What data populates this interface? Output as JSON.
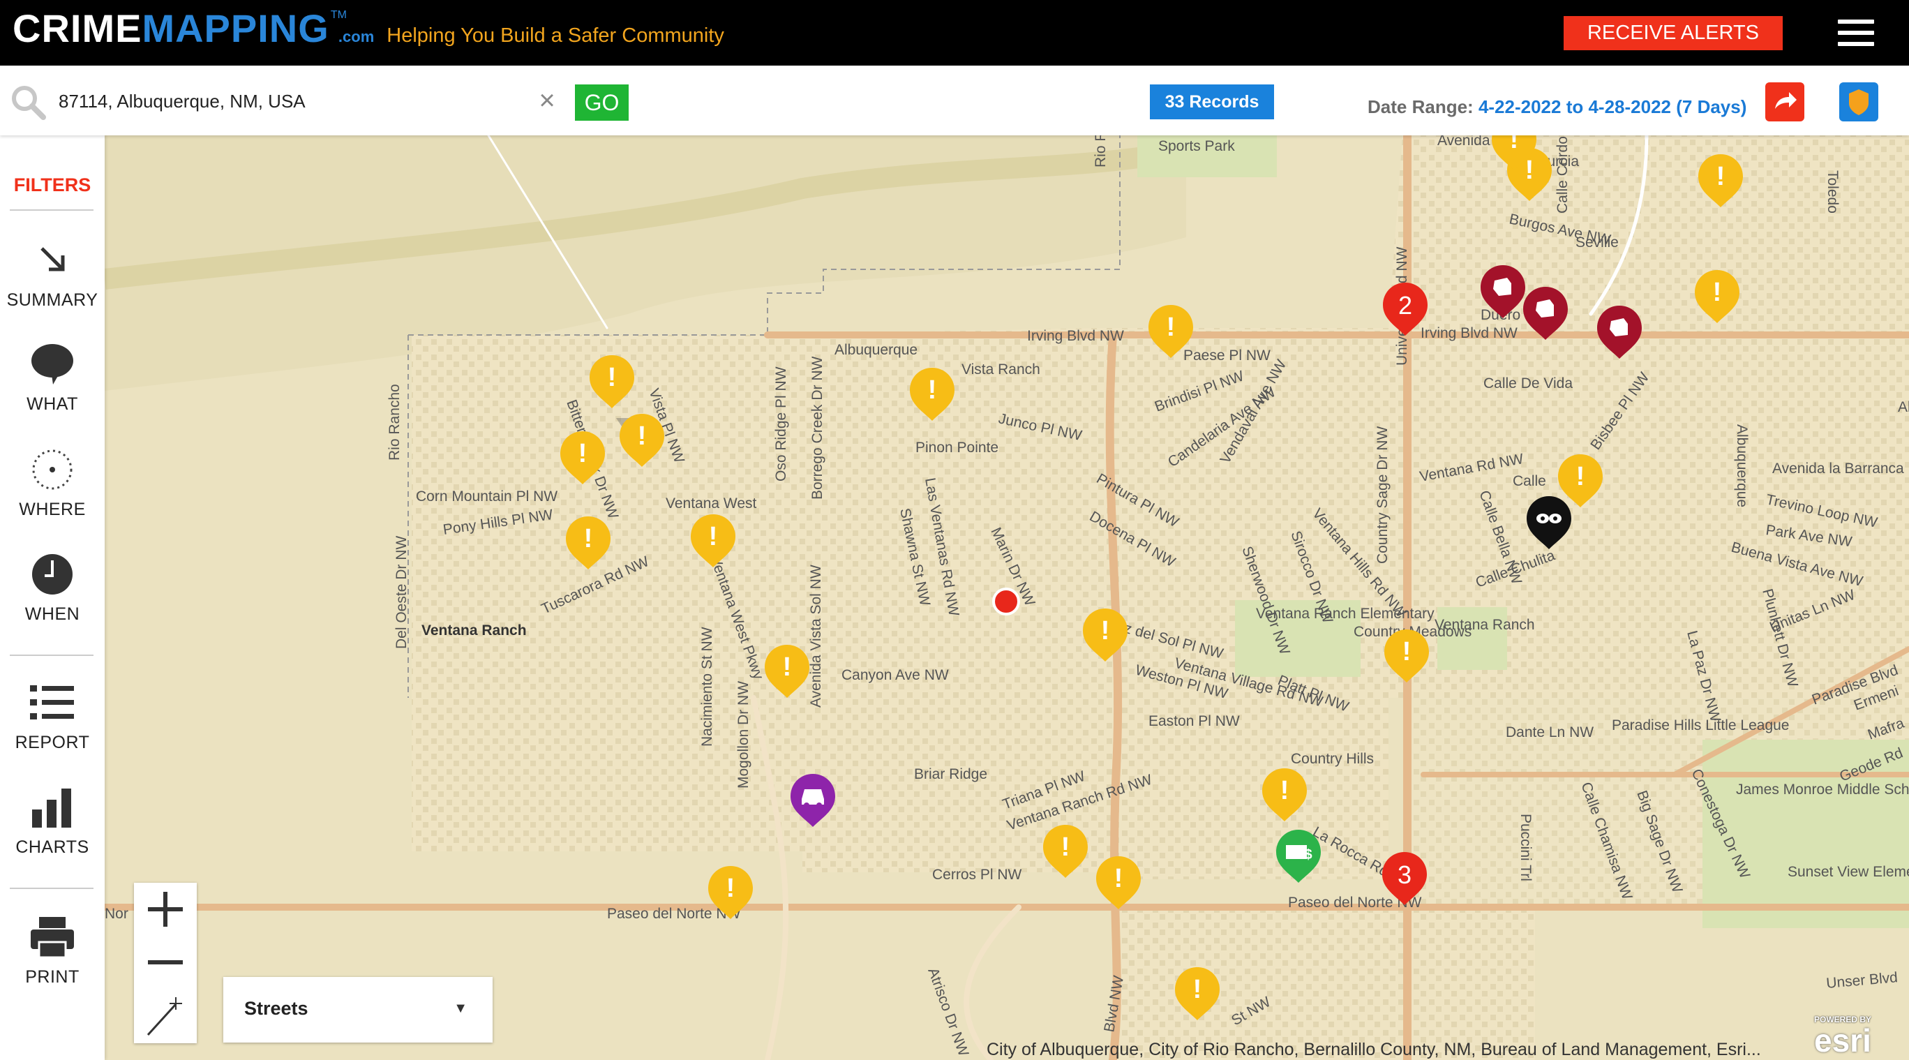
{
  "header": {
    "logo_part1": "CRIME",
    "logo_part2": "MAPPING",
    "logo_tm": "TM",
    "logo_dotcom": ".com",
    "tagline": "Helping You Build a Safer Community",
    "alerts_label": "RECEIVE ALERTS",
    "menu_icon": "hamburger-menu-icon"
  },
  "search": {
    "value": "87114, Albuquerque, NM, USA",
    "clear_icon": "close-icon",
    "go_label": "GO",
    "records_label": "33 Records",
    "date_range_label": "Date Range:",
    "date_range_value": "4-22-2022 to 4-28-2022 (7 Days)"
  },
  "sidebar": {
    "filters_label": "FILTERS",
    "items": [
      {
        "label": "SUMMARY",
        "icon": "arrow-down-right-icon"
      },
      {
        "label": "WHAT",
        "icon": "speech-bubble-icon"
      },
      {
        "label": "WHERE",
        "icon": "dotted-circle-icon"
      },
      {
        "label": "WHEN",
        "icon": "clock-icon"
      },
      {
        "label": "REPORT",
        "icon": "list-icon"
      },
      {
        "label": "CHARTS",
        "icon": "bar-chart-icon"
      },
      {
        "label": "PRINT",
        "icon": "printer-icon"
      }
    ]
  },
  "map": {
    "basemap_selected": "Streets",
    "attribution": "City of Albuquerque, City of Rio Rancho, Bernalillo County, NM, Bureau of Land Management, Esri...",
    "esri_powered": "POWERED BY",
    "esri_brand": "esri",
    "cluster_counts": [
      "2",
      "3"
    ],
    "colors": {
      "other": "#f7bd16",
      "assault": "#a3122a",
      "burglary": "#111111",
      "vehicle": "#8e24aa",
      "fraud": "#2cb34a",
      "cluster": "#e8271b"
    },
    "street_labels": [
      "Sports Park",
      "Avenida",
      "Murcia",
      "Burgos Ave NW",
      "Seville",
      "Irving Blvd NW",
      "Irving Blvd NW",
      "Paese Pl NW",
      "Duero",
      "Albuquerque",
      "Junco Pl NW",
      "Brindisi Pl NW",
      "Candelaria Ave NW",
      "Vendaval Ave NW",
      "Calle De Vida",
      "Bisbee Pl NW",
      "Ventana Rd NW",
      "Calle",
      "Avenida la Barranca",
      "Trevino Loop NW",
      "Park Ave NW",
      "Buena Vista Ave NW",
      "Unitas Ln NW",
      "Corn Mountain Pl NW",
      "Pony Hills Pl NW",
      "Ventana West",
      "Tuscarora Rd NW",
      "Ventana Ranch",
      "Pinon Pointe",
      "Pintura Pl NW",
      "Docena Pl NW",
      "Ventana Hills Rd NW",
      "Calle Chulita",
      "Country Sage Dr NW",
      "Del Oeste Dr NW",
      "Rio Rancho",
      "Marin Dr NW",
      "Canyon Ave NW",
      "z del Sol Pl NW",
      "Ventana Village Rd NW",
      "Weston Pl NW",
      "Platt Pl NW",
      "Ventana Ranch Elementary",
      "Country Meadows",
      "Ventana Ranch",
      "Easton Pl NW",
      "Dante Ln NW",
      "Paradise Hills Little League",
      "Paradise Blvd",
      "Ermeni",
      "Mafra",
      "Geode Rd",
      "James Monroe Middle School",
      "Nacimiento St NW",
      "Mogollon Dr NW",
      "Briar Ridge",
      "Triana Pl NW",
      "Ventana Ranch Rd NW",
      "Country Hills",
      "Cerros Pl NW",
      "La Rocca Rd NW",
      "Paseo del Norte NW",
      "Paseo del Norte NW",
      "Sunset View Elementary",
      "Unser Blvd",
      "Atrisco Dr NW",
      "Blvd NW",
      "St NW",
      "Nor",
      "Oso Ridge Pl NW",
      "Borrego Creek Dr NW",
      "Shawna St NW",
      "Las Ventanas Rd NW",
      "Ventana West Pkwy",
      "Avenida Vista Sol NW",
      "Alegre",
      "Toledo",
      "Calle Cordoba",
      "Vista Ranch",
      "Puccini Trl",
      "Calle Chamisa NW",
      "Big Sage Dr NW",
      "Conestoga Dr NW",
      "La Paz Dr NW",
      "Plunkett Dr NW",
      "Albuquerque",
      "Universe Blvd NW",
      "Calle Bella NW",
      "Sirocco Dr NW",
      "Sherwood Dr NW",
      "Bitter Creek Dr NW",
      "Vista Pl NW",
      "Rio Rancho"
    ]
  }
}
